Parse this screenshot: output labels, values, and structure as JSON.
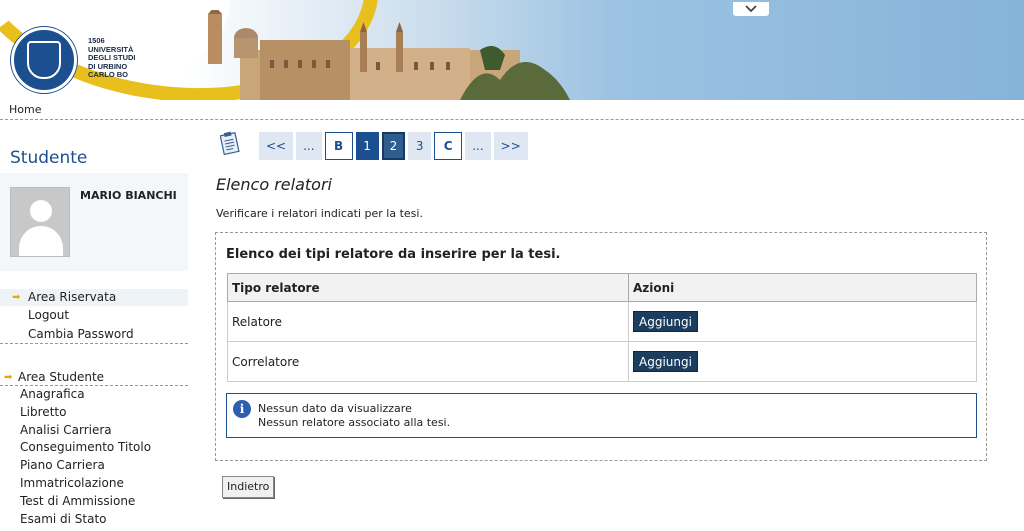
{
  "header": {
    "logo_text": [
      "1506",
      "UNIVERSITÀ",
      "DEGLI STUDI",
      "DI URBINO",
      "CARLO BO"
    ]
  },
  "breadcrumb": {
    "home": "Home"
  },
  "sidebar": {
    "title": "Studente",
    "profile_name": "MARIO BIANCHI",
    "area_riservata": {
      "header": "Area Riservata",
      "items": [
        "Logout",
        "Cambia Password"
      ]
    },
    "area_studente": {
      "header": "Area Studente",
      "items": [
        "Anagrafica",
        "Libretto",
        "Analisi Carriera",
        "Conseguimento Titolo",
        "Piano Carriera",
        "Immatricolazione",
        "Test di Ammissione",
        "Esami di Stato"
      ]
    }
  },
  "pager": [
    "<<",
    "...",
    "B",
    "1",
    "2",
    "3",
    "C",
    "...",
    ">>"
  ],
  "main": {
    "title": "Elenco relatori",
    "description": "Verificare i relatori indicati per la tesi.",
    "panel_title": "Elenco dei tipi relatore da inserire per la tesi.",
    "columns": [
      "Tipo relatore",
      "Azioni"
    ],
    "rows": [
      {
        "tipo": "Relatore",
        "action": "Aggiungi"
      },
      {
        "tipo": "Correlatore",
        "action": "Aggiungi"
      }
    ],
    "info_line1": "Nessun dato da visualizzare",
    "info_line2": "Nessun relatore associato alla tesi.",
    "back_button": "Indietro"
  },
  "colors": {
    "brand_blue": "#1c4f8f",
    "accent_yellow": "#e8bf1c",
    "button_dark": "#1c3e5e"
  }
}
